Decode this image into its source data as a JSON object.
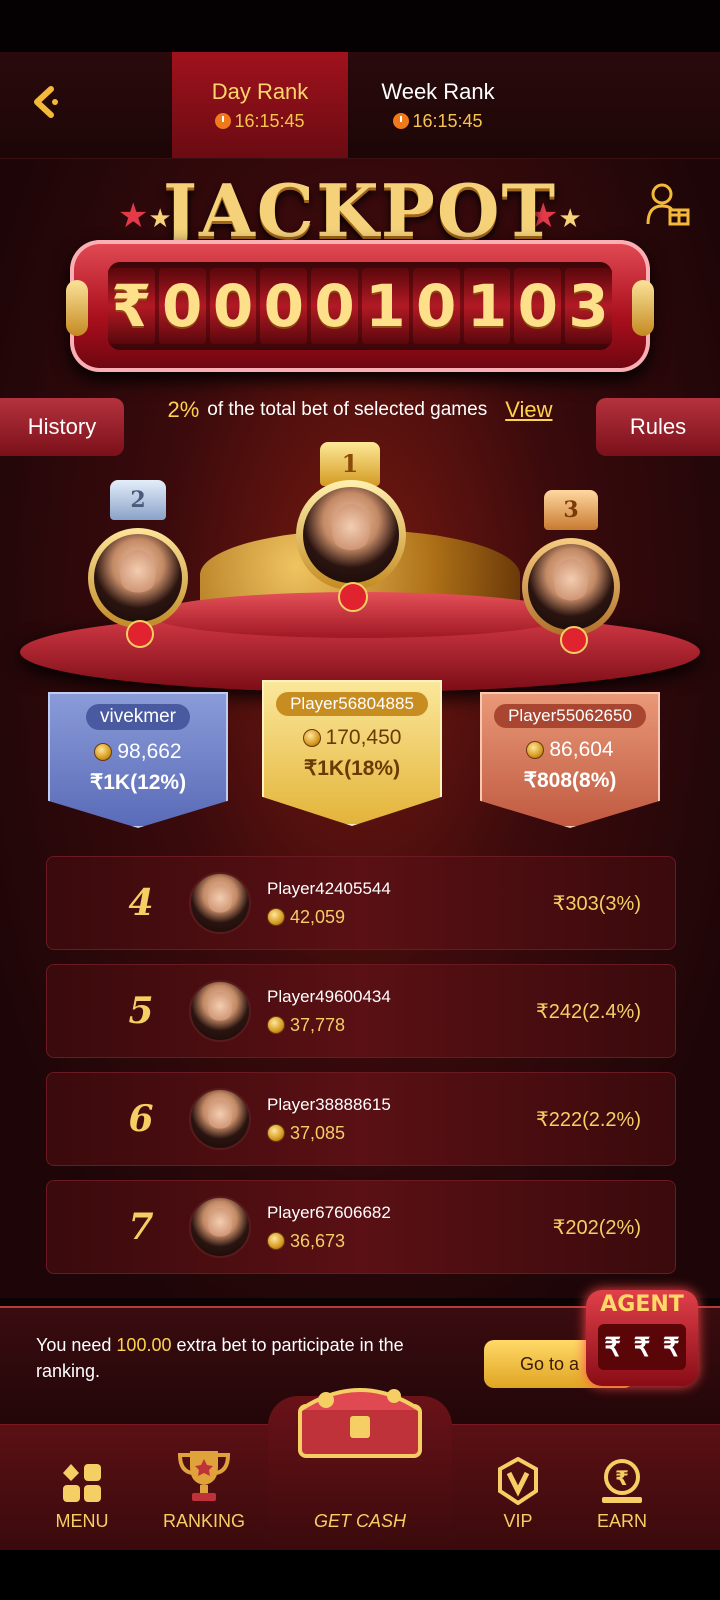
{
  "header": {
    "tabs": [
      {
        "label": "Day Rank",
        "time": "16:15:45",
        "active": true
      },
      {
        "label": "Week Rank",
        "time": "16:15:45",
        "active": false
      }
    ]
  },
  "jackpot": {
    "title": "JACKPOT",
    "currency": "₹",
    "digits": [
      "0",
      "0",
      "0",
      "0",
      "1",
      "0",
      "1",
      "0",
      "3"
    ],
    "info_pct": "2%",
    "info_text": "of the total bet of selected games",
    "view_label": "View"
  },
  "side": {
    "history": "History",
    "rules": "Rules"
  },
  "podium": [
    {
      "rank": "2",
      "name": "vivekmer",
      "score": "98,662",
      "prize": "₹1K(12%)"
    },
    {
      "rank": "1",
      "name": "Player56804885",
      "score": "170,450",
      "prize": "₹1K(18%)"
    },
    {
      "rank": "3",
      "name": "Player55062650",
      "score": "86,604",
      "prize": "₹808(8%)"
    }
  ],
  "list": [
    {
      "rank": "4",
      "name": "Player42405544",
      "score": "42,059",
      "prize": "₹303(3%)"
    },
    {
      "rank": "5",
      "name": "Player49600434",
      "score": "37,778",
      "prize": "₹242(2.4%)"
    },
    {
      "rank": "6",
      "name": "Player38888615",
      "score": "37,085",
      "prize": "₹222(2.2%)"
    },
    {
      "rank": "7",
      "name": "Player67606682",
      "score": "36,673",
      "prize": "₹202(2%)"
    }
  ],
  "banner": {
    "text_before": "You need ",
    "amount": "100.00",
    "text_after": " extra bet to participate in the ranking.",
    "button": "Go to a"
  },
  "agent": {
    "label": "AGENT",
    "symbols": [
      "₹",
      "₹",
      "₹"
    ]
  },
  "nav": {
    "menu": "MENU",
    "ranking": "RANKING",
    "get_cash": "GET CASH",
    "vip": "VIP",
    "earn": "EARN"
  },
  "colors": {
    "accent_gold": "#f5cf63",
    "deep_red": "#3a0a0c",
    "active_tab": "#a0121d"
  }
}
